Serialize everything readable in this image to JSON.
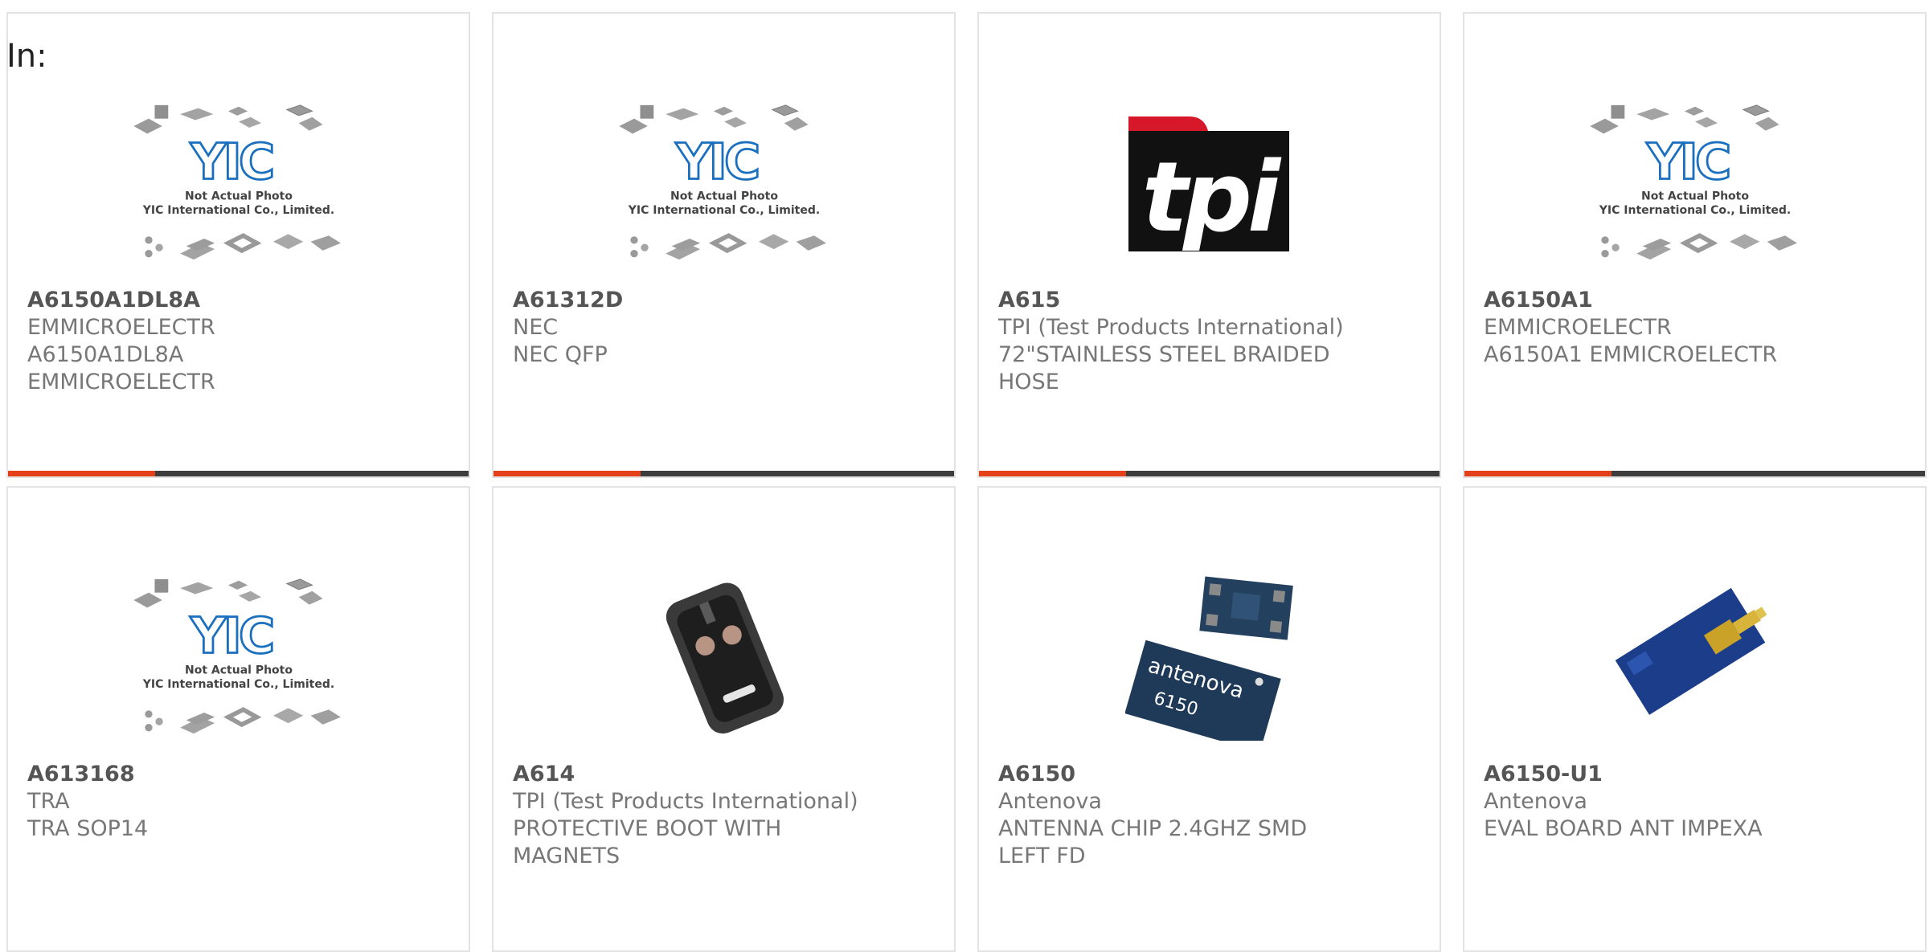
{
  "filter_label": "In:",
  "placeholder": {
    "line1": "Not Actual Photo",
    "line2": "YIC International Co., Limited."
  },
  "colors": {
    "accent": "#e4411b",
    "bar": "#3d3d3d",
    "yic_blue": "#1a6fbf",
    "tpi_red": "#d6182a"
  },
  "products": [
    {
      "part": "A6150A1DL8A",
      "maker": "EMMICROELECTR",
      "desc": "A6150A1DL8A EMMICROELECTR",
      "image": "yic-placeholder-icon"
    },
    {
      "part": "A61312D",
      "maker": "NEC",
      "desc": "NEC QFP",
      "image": "yic-placeholder-icon"
    },
    {
      "part": "A615",
      "maker": "TPI (Test Products International)",
      "desc": "72\"STAINLESS STEEL BRAIDED HOSE",
      "image": "tpi-logo",
      "logo_text": "tpi"
    },
    {
      "part": "A6150A1",
      "maker": "EMMICROELECTR",
      "desc": "A6150A1 EMMICROELECTR",
      "image": "yic-placeholder-icon"
    },
    {
      "part": "A613168",
      "maker": "TRA",
      "desc": "TRA SOP14",
      "image": "yic-placeholder-icon"
    },
    {
      "part": "A614",
      "maker": "TPI (Test Products International)",
      "desc": "PROTECTIVE BOOT WITH MAGNETS",
      "image": "protective-boot-photo"
    },
    {
      "part": "A6150",
      "maker": "Antenova",
      "desc": "ANTENNA CHIP 2.4GHZ SMD LEFT FD",
      "image": "antenna-chip-photo",
      "chip_brand": "antenova",
      "chip_code": "6150"
    },
    {
      "part": "A6150-U1",
      "maker": "Antenova",
      "desc": "EVAL BOARD ANT IMPEXA",
      "image": "eval-board-photo"
    }
  ]
}
